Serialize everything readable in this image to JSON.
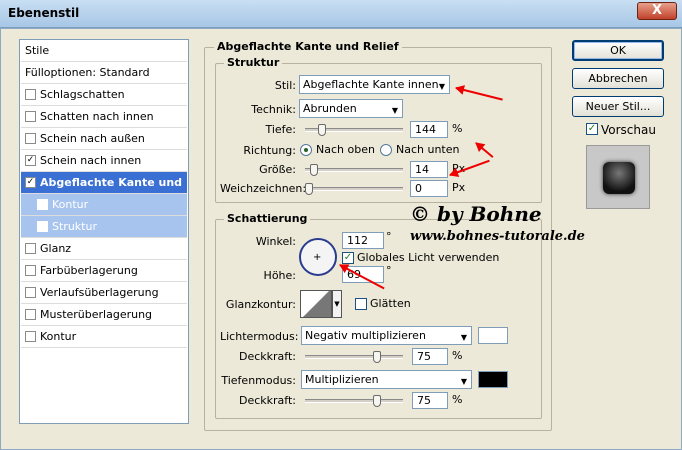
{
  "window": {
    "title": "Ebenenstil",
    "close": "X"
  },
  "sidebar": {
    "items": [
      {
        "label": "Stile",
        "type": "header",
        "checked": false
      },
      {
        "label": "Fülloptionen: Standard",
        "type": "header",
        "checked": false
      },
      {
        "label": "Schlagschatten",
        "type": "item",
        "checked": false
      },
      {
        "label": "Schatten nach innen",
        "type": "item",
        "checked": false
      },
      {
        "label": "Schein nach außen",
        "type": "item",
        "checked": false
      },
      {
        "label": "Schein nach innen",
        "type": "item",
        "checked": true
      },
      {
        "label": "Abgeflachte Kante und Relief",
        "type": "selected",
        "checked": true
      },
      {
        "label": "Kontur",
        "type": "sub",
        "checked": false
      },
      {
        "label": "Struktur",
        "type": "sub",
        "checked": false
      },
      {
        "label": "Glanz",
        "type": "item",
        "checked": false
      },
      {
        "label": "Farbüberlagerung",
        "type": "item",
        "checked": false
      },
      {
        "label": "Verlaufsüberlagerung",
        "type": "item",
        "checked": false
      },
      {
        "label": "Musterüberlagerung",
        "type": "item",
        "checked": false
      },
      {
        "label": "Kontur",
        "type": "item",
        "checked": false
      }
    ]
  },
  "main": {
    "section_title": "Abgeflachte Kante und Relief",
    "struktur": {
      "title": "Struktur",
      "stil_label": "Stil:",
      "stil_value": "Abgeflachte Kante innen",
      "technik_label": "Technik:",
      "technik_value": "Abrunden",
      "tiefe_label": "Tiefe:",
      "tiefe_value": "144",
      "tiefe_unit": "%",
      "tiefe_slider": 0.14,
      "richtung_label": "Richtung:",
      "richtung_up": "Nach oben",
      "richtung_down": "Nach unten",
      "groesse_label": "Größe:",
      "groesse_value": "14",
      "groesse_unit": "Px",
      "groesse_slider": 0.06,
      "weich_label": "Weichzeichnen:",
      "weich_value": "0",
      "weich_unit": "Px",
      "weich_slider": 0.0
    },
    "schattierung": {
      "title": "Schattierung",
      "winkel_label": "Winkel:",
      "winkel_value": "112",
      "winkel_unit": "°",
      "global_light_label": "Globales Licht verwenden",
      "global_light_checked": true,
      "hoehe_label": "Höhe:",
      "hoehe_value": "69",
      "hoehe_unit": "°",
      "glanzkontur_label": "Glanzkontur:",
      "glaetten_label": "Glätten",
      "glaetten_checked": false,
      "lichtermodus_label": "Lichtermodus:",
      "lichtermodus_value": "Negativ multiplizieren",
      "lichter_color": "#ffffff",
      "deckkraft1_label": "Deckkraft:",
      "deckkraft1_value": "75",
      "deckkraft1_unit": "%",
      "deckkraft1_slider": 0.75,
      "tiefenmodus_label": "Tiefenmodus:",
      "tiefenmodus_value": "Multiplizieren",
      "tiefen_color": "#000000",
      "deckkraft2_label": "Deckkraft:",
      "deckkraft2_value": "75",
      "deckkraft2_unit": "%",
      "deckkraft2_slider": 0.75
    }
  },
  "buttons": {
    "ok": "OK",
    "cancel": "Abbrechen",
    "new_style": "Neuer Stil...",
    "preview_label": "Vorschau",
    "preview_checked": true
  },
  "watermark": {
    "line1": "© by Bohne",
    "line2": "www.bohnes-tutorale.de"
  },
  "colors": {
    "accent": "#3a6fd4",
    "arrow": "#e00000"
  }
}
